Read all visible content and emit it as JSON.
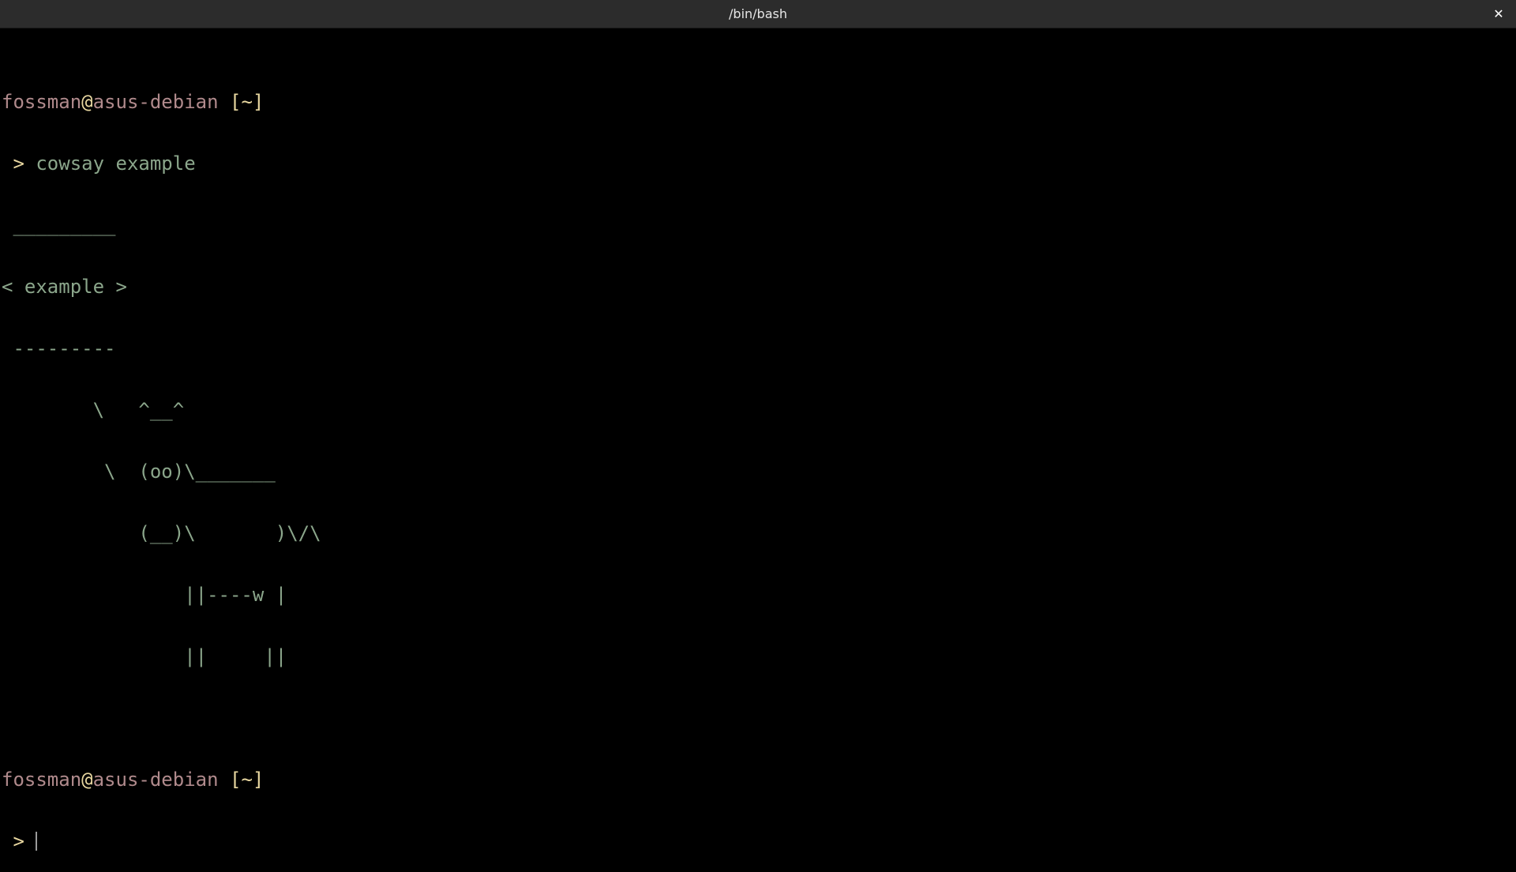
{
  "window": {
    "title": "/bin/bash",
    "close_label": "✕"
  },
  "prompt": {
    "user": "fossman",
    "at": "@",
    "host": "asus-debian",
    "dir": " [~]",
    "arrow": " > "
  },
  "session": {
    "command": "cowsay example",
    "output": [
      " _________",
      "< example >",
      " ---------",
      "        \\   ^__^",
      "         \\  (oo)\\_______",
      "            (__)\\       )\\/\\",
      "                ||----w |",
      "                ||     ||"
    ]
  },
  "colors": {
    "background": "#000000",
    "titlebar": "#2c2c2c",
    "prompt_user": "#b08a8c",
    "prompt_accent": "#e8d7a0",
    "text": "#8ba68b"
  }
}
